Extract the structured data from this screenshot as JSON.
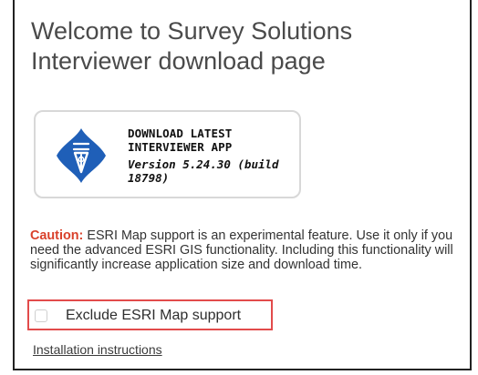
{
  "page": {
    "title": "Welcome to Survey Solutions Interviewer download page"
  },
  "download_card": {
    "title": "DOWNLOAD LATEST INTERVIEWER APP",
    "version": "Version 5.24.30 (build 18798)",
    "icon": "pen-nib-logo-icon",
    "icon_color": "#1f5fb8"
  },
  "caution": {
    "label": "Caution:",
    "text": " ESRI Map support is an experimental feature. Use it only if you need the advanced ESRI GIS functionality. Including this functionality will significantly increase application size and download time.",
    "label_color": "#d9412b"
  },
  "exclude_esri": {
    "label": "Exclude ESRI Map support",
    "checked": false,
    "highlight_color": "#e24b4b"
  },
  "links": {
    "installation_instructions": "Installation instructions"
  }
}
